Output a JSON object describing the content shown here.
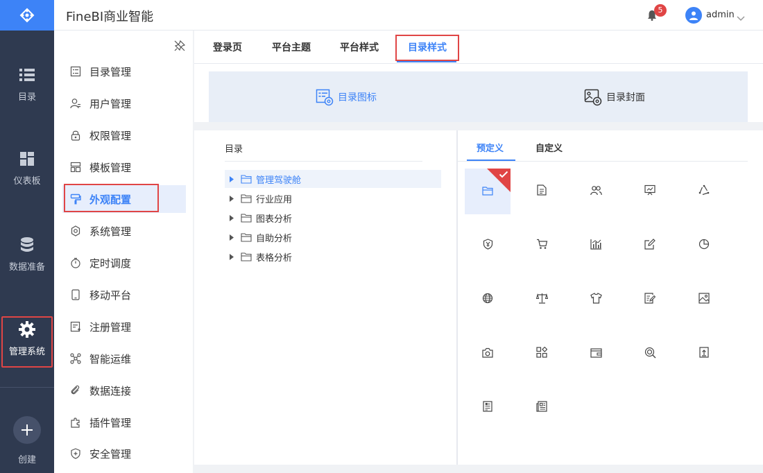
{
  "app": {
    "title": "FineBI商业智能"
  },
  "header": {
    "notification_count": "5",
    "username": "admin"
  },
  "rail": {
    "items": [
      {
        "label": "目录",
        "icon": "list-icon"
      },
      {
        "label": "仪表板",
        "icon": "dashboard-icon"
      },
      {
        "label": "数据准备",
        "icon": "database-icon"
      },
      {
        "label": "管理系统",
        "icon": "gear-icon",
        "active": true
      },
      {
        "label": "创建",
        "icon": "plus-icon"
      }
    ]
  },
  "submenu": {
    "items": [
      {
        "label": "目录管理",
        "icon": "catalog-icon"
      },
      {
        "label": "用户管理",
        "icon": "user-icon"
      },
      {
        "label": "权限管理",
        "icon": "lock-icon"
      },
      {
        "label": "模板管理",
        "icon": "template-icon"
      },
      {
        "label": "外观配置",
        "icon": "brush-icon",
        "active": true
      },
      {
        "label": "系统管理",
        "icon": "settings-icon"
      },
      {
        "label": "定时调度",
        "icon": "timer-icon"
      },
      {
        "label": "移动平台",
        "icon": "mobile-icon"
      },
      {
        "label": "注册管理",
        "icon": "register-icon"
      },
      {
        "label": "智能运维",
        "icon": "ops-icon"
      },
      {
        "label": "数据连接",
        "icon": "link-icon"
      },
      {
        "label": "插件管理",
        "icon": "plugin-icon"
      },
      {
        "label": "安全管理",
        "icon": "shield-icon"
      }
    ]
  },
  "tabs": [
    {
      "label": "登录页"
    },
    {
      "label": "平台主题"
    },
    {
      "label": "平台样式"
    },
    {
      "label": "目录样式",
      "active": true
    }
  ],
  "modes": [
    {
      "label": "目录图标",
      "icon": "catalog-icon-setting-icon",
      "active": true
    },
    {
      "label": "目录封面",
      "icon": "catalog-cover-icon"
    }
  ],
  "tree": {
    "title": "目录",
    "items": [
      {
        "label": "管理驾驶舱",
        "selected": true
      },
      {
        "label": "行业应用"
      },
      {
        "label": "图表分析"
      },
      {
        "label": "自助分析"
      },
      {
        "label": "表格分析"
      }
    ]
  },
  "icon_tabs": [
    {
      "label": "预定义",
      "active": true
    },
    {
      "label": "自定义"
    }
  ],
  "icon_grid": [
    "folder-icon",
    "document-icon",
    "users-icon",
    "presentation-icon",
    "recycle-icon",
    "shield-yen-icon",
    "cart-icon",
    "bar-chart-icon",
    "edit-icon",
    "pie-chart-icon",
    "globe-icon",
    "scale-icon",
    "shirt-icon",
    "notes-icon",
    "image-icon",
    "camera-icon",
    "apps-icon",
    "wallet-icon",
    "search-target-icon",
    "upload-icon",
    "invoice-icon",
    "news-icon"
  ],
  "colors": {
    "primary": "#3d83f7",
    "rail_bg": "#2f3a50",
    "highlight": "#e04545"
  }
}
